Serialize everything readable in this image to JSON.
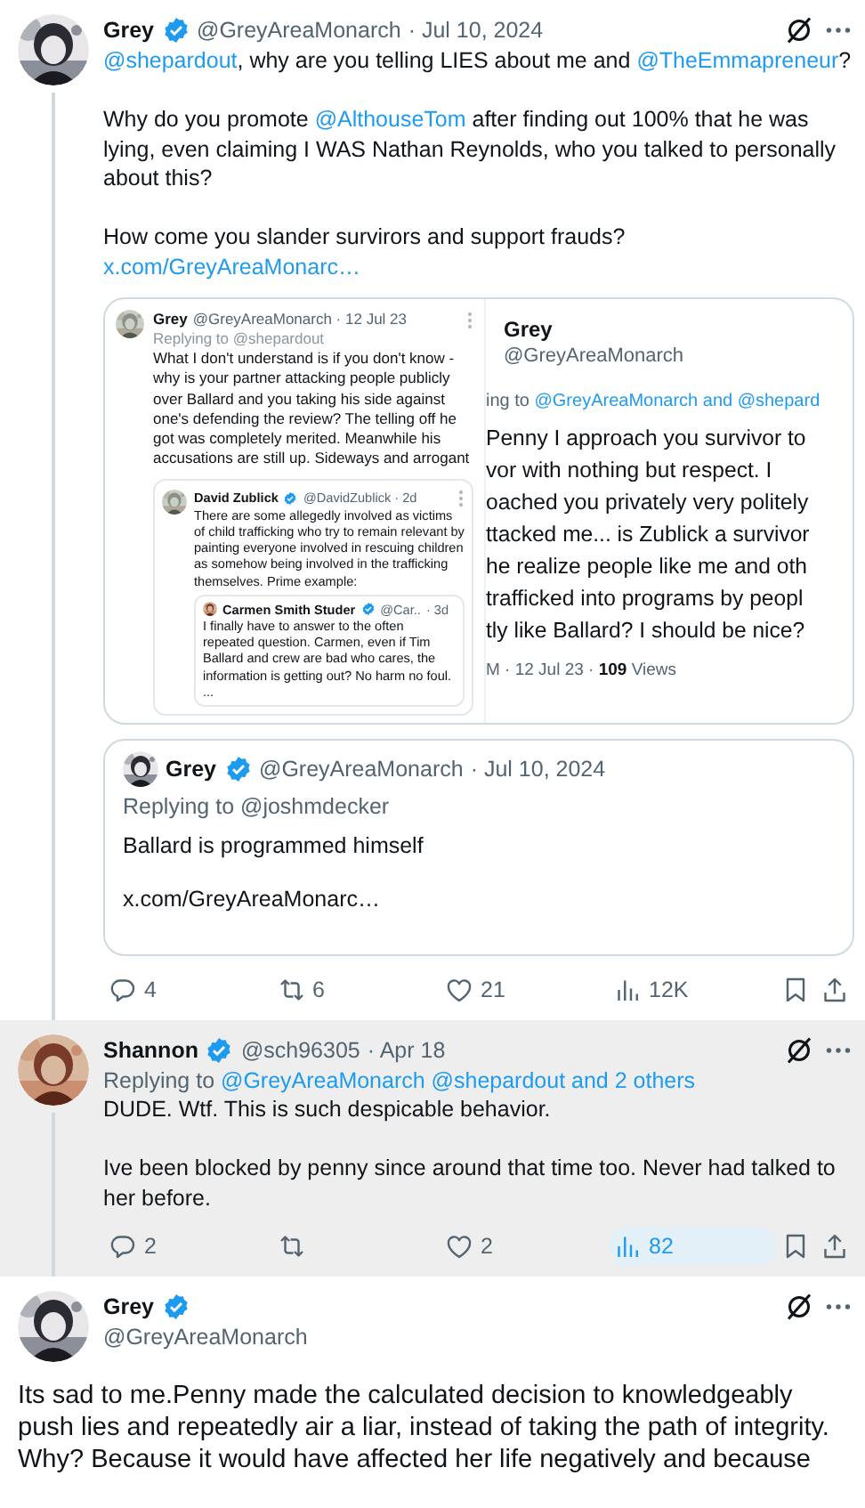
{
  "tweets": [
    {
      "kind": "thread",
      "name": "Grey",
      "verified": true,
      "handle": "@GreyAreaMonarch",
      "date": "· Jul 10, 2024",
      "highlighted": false,
      "connected_below": true,
      "paragraphs": [
        [
          {
            "kind": "link",
            "text": "@shepardout"
          },
          {
            "kind": "plain",
            "text": ", why are you telling LIES about me and "
          },
          {
            "kind": "link",
            "text": "@TheEmmapreneur"
          },
          {
            "kind": "plain",
            "text": "?"
          }
        ],
        [
          {
            "kind": "plain",
            "text": "Why do you promote "
          },
          {
            "kind": "link",
            "text": "@AlthouseTom"
          },
          {
            "kind": "plain",
            "text": " after finding out 100% that he was lying, even claiming I WAS Nathan Reynolds, who you talked to personally about this?"
          }
        ],
        [
          {
            "kind": "plain",
            "text": "How come you slander survirors and support frauds?"
          },
          {
            "kind": "url",
            "text": "x.com/GreyAreaMonarc…"
          }
        ]
      ],
      "screenshot": {
        "left": {
          "name": "Grey",
          "handle": "@GreyAreaMonarch · 12 Jul 23",
          "replying": "Replying to @shepardout",
          "text": "What I don't understand is if you don't know - why is your partner attacking people publicly over Ballard and you taking his side against one's defending the review? The telling off he got was completely merited. Meanwhile his accusations are still up. Sideways and arrogant",
          "quote": {
            "name": "David Zublick",
            "verified": true,
            "handle": "@DavidZublick · 2d",
            "text": "There are some allegedly involved as victims of child trafficking who try to remain relevant by painting everyone involved in rescuing children as somehow being involved in the trafficking themselves. Prime example:",
            "quote": {
              "name": "Carmen Smith Studer",
              "verified": true,
              "handle": "@Car..",
              "date": "· 3d",
              "text": "I finally have to answer to the often repeated question. Carmen, even if Tim Ballard and crew are bad who cares, the information is getting out? No harm no foul. ..."
            }
          }
        },
        "right": {
          "name": "Grey",
          "handle": "@GreyAreaMonarch",
          "replying": "ing to",
          "replying_links": "@GreyAreaMonarch and @shepard",
          "lines": [
            "Penny I approach you survivor to",
            "vor with nothing but respect. I",
            "oached you privately very politely",
            "ttacked me... is Zublick a survivor",
            "he realize people like me and oth",
            "trafficked into programs by peopl",
            "tly like Ballard? I should be nice?"
          ],
          "meta": "M · 12 Jul 23 · **109** Views"
        }
      },
      "quote": {
        "name": "Grey",
        "verified": true,
        "handle": "@GreyAreaMonarch",
        "date": "· Jul 10, 2024",
        "replying": "Replying to @joshmdecker",
        "paragraphs": [
          "Ballard is programmed himself",
          "x.com/GreyAreaMonarc…"
        ]
      },
      "actions": [
        {
          "kind": "reply",
          "count": "4",
          "highlighted": false
        },
        {
          "kind": "repost",
          "count": "6",
          "highlighted": false
        },
        {
          "kind": "like",
          "count": "21",
          "highlighted": false
        },
        {
          "kind": "views",
          "count": "12K",
          "highlighted": false
        },
        {
          "kind": "bookmark",
          "highlighted": false
        },
        {
          "kind": "share",
          "highlighted": false
        }
      ]
    },
    {
      "kind": "thread",
      "name": "Shannon",
      "verified": true,
      "handle": "@sch96305",
      "date": "· Apr 18",
      "highlighted": true,
      "connected_below": true,
      "replying": [
        {
          "kind": "plain",
          "text": "Replying to "
        },
        {
          "kind": "link",
          "text": "@GreyAreaMonarch @shepardout and 2 others"
        }
      ],
      "paragraphs": [
        [
          {
            "kind": "plain",
            "text": "DUDE. Wtf. This is such despicable behavior."
          }
        ],
        [
          {
            "kind": "plain",
            "text": "Ive been blocked by penny since around that time too. Never had talked to her before."
          }
        ]
      ],
      "actions": [
        {
          "kind": "reply",
          "count": "2",
          "highlighted": false
        },
        {
          "kind": "repost",
          "highlighted": false
        },
        {
          "kind": "like",
          "count": "2",
          "highlighted": false
        },
        {
          "kind": "views",
          "count": "82",
          "highlighted": true
        },
        {
          "kind": "bookmark",
          "highlighted": false
        },
        {
          "kind": "share",
          "highlighted": false
        }
      ]
    },
    {
      "kind": "focal",
      "name": "Grey",
      "verified": true,
      "handle": "@GreyAreaMonarch",
      "highlighted": false,
      "paragraphs": [
        [
          {
            "kind": "plain",
            "text": "Its sad to me.Penny made the calculated decision to knowledgeably push lies and repeatedly air a liar, instead of taking the path of integrity. Why? Because it would have affected her life negatively and because"
          }
        ]
      ]
    }
  ]
}
